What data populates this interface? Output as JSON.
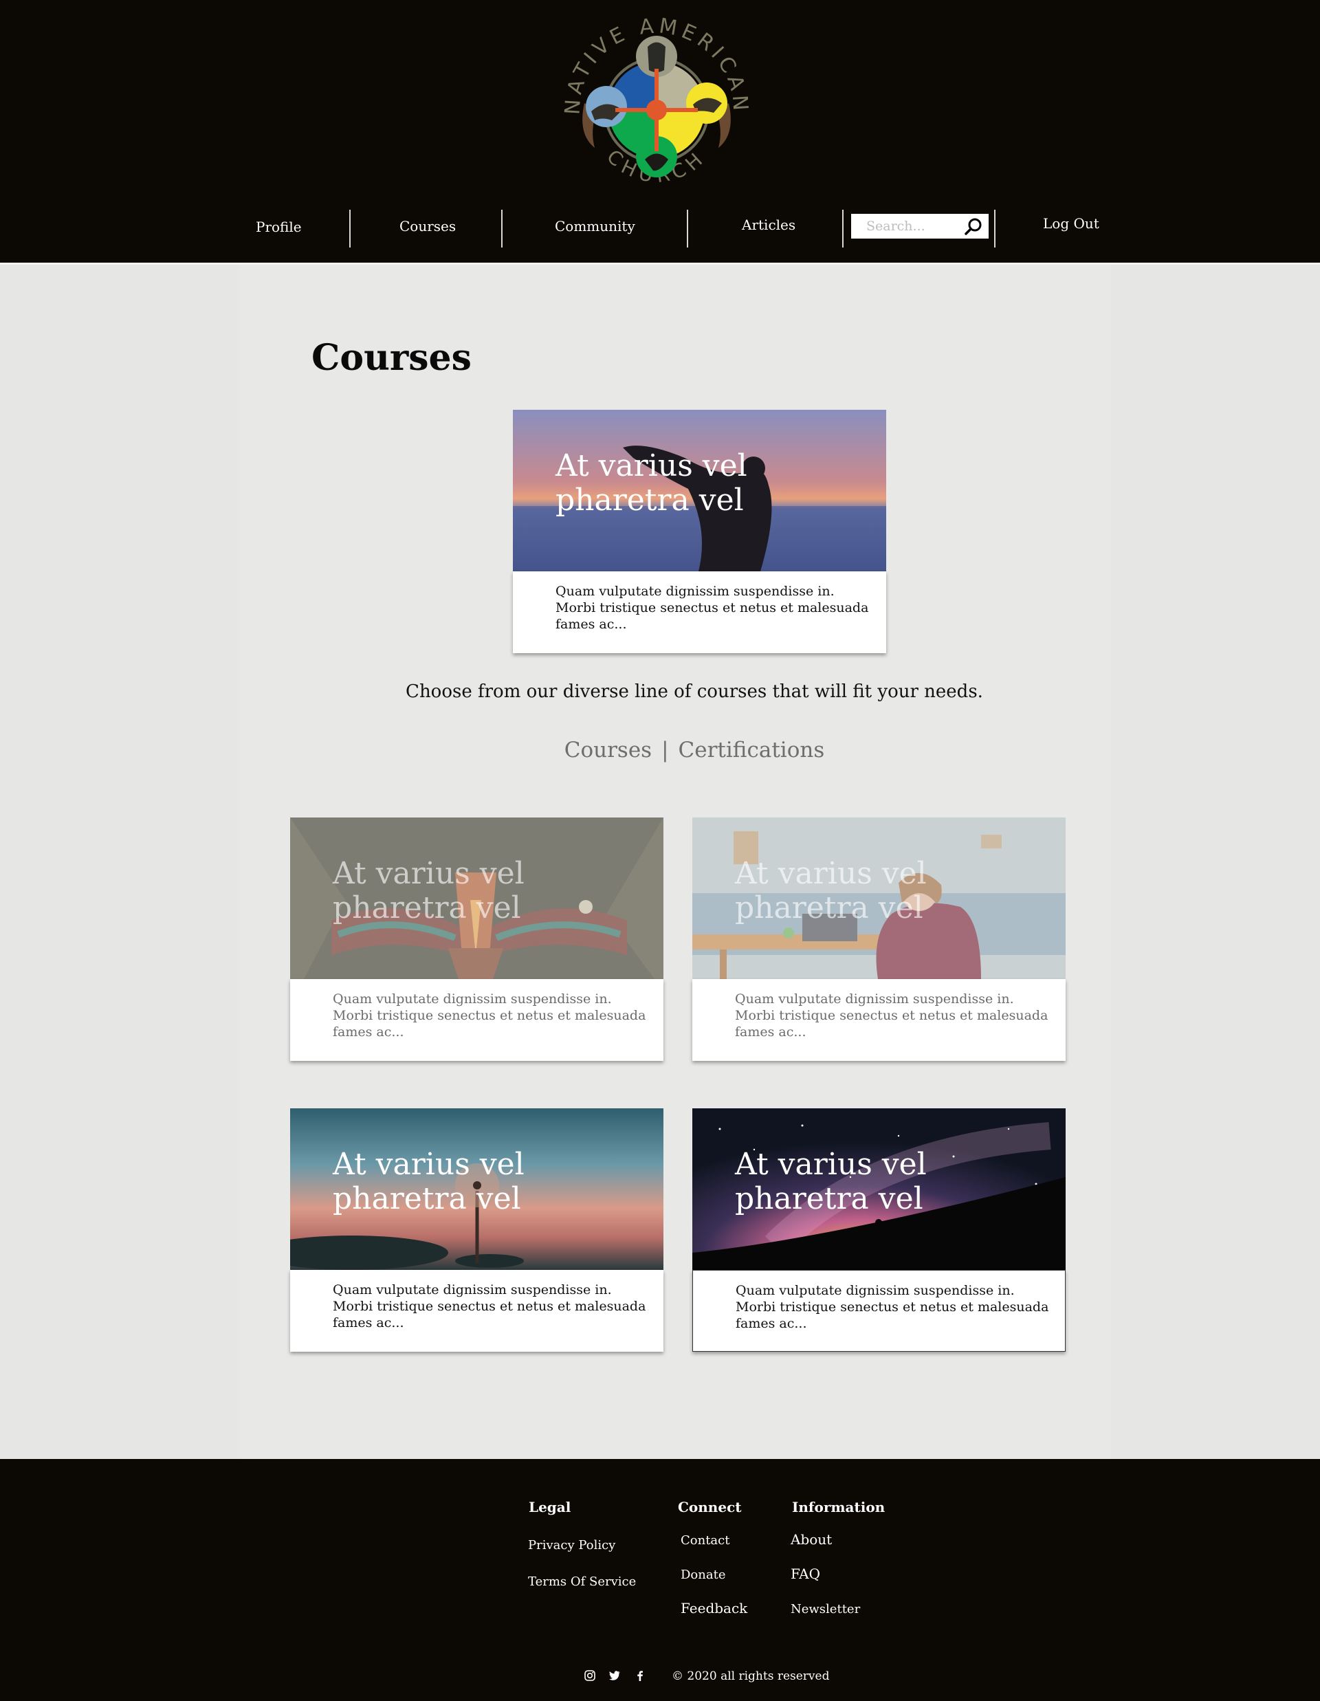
{
  "header": {
    "logo": {
      "icon": "native-american-church-logo",
      "text_top": "NATIVE AMERICAN",
      "text_bottom": "CHURCH",
      "colors": {
        "blue": "#1f5aa8",
        "yellow": "#f4e32a",
        "green": "#0ea84d",
        "center": "#e1582a",
        "ring": "#6b6a55"
      }
    },
    "nav": {
      "profile": "Profile",
      "courses": "Courses",
      "community": "Community",
      "articles": "Articles",
      "logout": "Log Out"
    },
    "search": {
      "placeholder": "Search...",
      "icon": "search-icon"
    }
  },
  "main": {
    "title": "Courses",
    "featured": {
      "title": "At varius vel pharetra vel",
      "text": "Quam vulputate dignissim suspendisse in. Morbi tristique senectus et netus et malesuada fames ac..."
    },
    "intro": "Choose from our diverse line of courses that will fit your needs.",
    "tabs": {
      "courses": "Courses",
      "separator": "|",
      "certifications": "Certifications"
    },
    "cards": [
      {
        "title": "At varius vel pharetra vel",
        "text": "Quam vulputate dignissim suspendisse in. Morbi tristique senectus et netus et malesuada fames ac...",
        "image": "totem-carving"
      },
      {
        "title": "At varius vel pharetra vel",
        "text": "Quam vulputate dignissim suspendisse in. Morbi tristique senectus et netus et malesuada fames ac...",
        "image": "woman-at-laptop"
      },
      {
        "title": "At varius vel pharetra vel",
        "text": "Quam vulputate dignissim suspendisse in. Morbi tristique senectus et netus et malesuada fames ac...",
        "image": "dandelion-sunset"
      },
      {
        "title": "At varius vel pharetra vel",
        "text": "Quam vulputate dignissim suspendisse in. Morbi tristique senectus et netus et malesuada fames ac...",
        "image": "milky-way"
      }
    ]
  },
  "footer": {
    "legal": {
      "heading": "Legal",
      "privacy": "Privacy Policy",
      "terms": "Terms Of Service"
    },
    "connect": {
      "heading": "Connect",
      "contact": "Contact",
      "donate": "Donate",
      "feedback": "Feedback"
    },
    "information": {
      "heading": "Information",
      "about": "About",
      "faq": "FAQ",
      "newsletter": "Newsletter"
    },
    "social": [
      "instagram-icon",
      "twitter-icon",
      "facebook-icon"
    ],
    "copyright": "© 2020 all rights reserved"
  }
}
